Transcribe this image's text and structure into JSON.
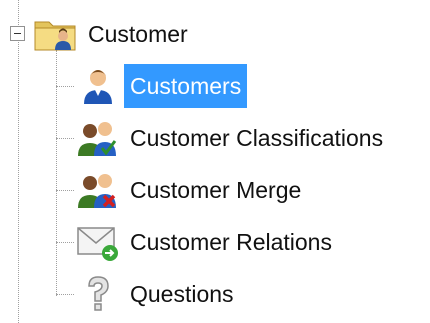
{
  "tree": {
    "root": {
      "label": "Customer",
      "icon": "folder-user-icon",
      "expanded": true
    },
    "children": [
      {
        "label": "Customers",
        "icon": "user-icon",
        "selected": true
      },
      {
        "label": "Customer Classifications",
        "icon": "users-check-icon",
        "selected": false
      },
      {
        "label": "Customer Merge",
        "icon": "users-remove-icon",
        "selected": false
      },
      {
        "label": "Customer Relations",
        "icon": "mail-arrow-icon",
        "selected": false
      },
      {
        "label": "Questions",
        "icon": "question-icon",
        "selected": false
      }
    ]
  },
  "colors": {
    "selection": "#3399ff",
    "selected_text": "#ffffff",
    "text": "#111111",
    "tree_lines": "#a0a0a0"
  }
}
